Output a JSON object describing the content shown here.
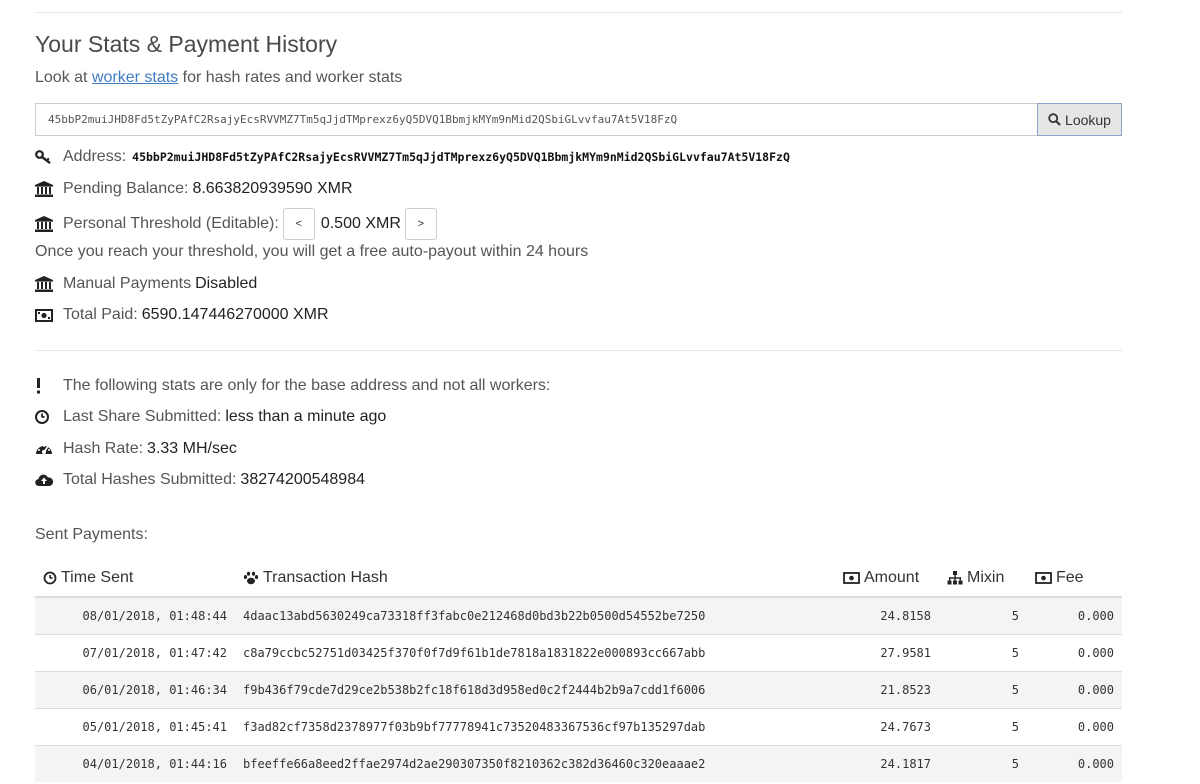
{
  "header": {
    "title": "Your Stats & Payment History",
    "subtitle_prefix": "Look at",
    "subtitle_link": "worker stats",
    "subtitle_suffix": "for hash rates and worker stats"
  },
  "lookup": {
    "value": "45bbP2muiJHD8Fd5tZyPAfC2RsajyEcsRVVMZ7Tm5qJjdTMprexz6yQ5DVQ1BbmjkMYm9nMid2QSbiGLvvfau7At5V18FzQ",
    "button_label": "Lookup",
    "button_icon": "search-icon"
  },
  "stats": {
    "address_label": "Address:",
    "address_value": "45bbP2muiJHD8Fd5tZyPAfC2RsajyEcsRVVMZ7Tm5qJjdTMprexz6yQ5DVQ1BbmjkMYm9nMid2QSbiGLvvfau7At5V18FzQ",
    "pending_label": "Pending Balance:",
    "pending_value": "8.663820939590 XMR",
    "threshold_label": "Personal Threshold (Editable):",
    "threshold_dec": "<",
    "threshold_value": "0.500 XMR",
    "threshold_inc": ">",
    "threshold_note": "Once you reach your threshold, you will get a free auto-payout within 24 hours",
    "manual_label": "Manual Payments",
    "manual_value": "Disabled",
    "total_paid_label": "Total Paid:",
    "total_paid_value": "6590.147446270000 XMR"
  },
  "base_stats": {
    "notice": "The following stats are only for the base address and not all workers:",
    "last_share_label": "Last Share Submitted:",
    "last_share_value": "less than a minute ago",
    "hash_rate_label": "Hash Rate:",
    "hash_rate_value": "3.33 MH/sec",
    "total_hashes_label": "Total Hashes Submitted:",
    "total_hashes_value": "38274200548984"
  },
  "payments": {
    "title": "Sent Payments:",
    "columns": [
      "Time Sent",
      "Transaction Hash",
      "Amount",
      "Mixin",
      "Fee"
    ],
    "rows": [
      {
        "time": "08/01/2018, 01:48:44",
        "hash": "4daac13abd5630249ca73318ff3fabc0e212468d0bd3b22b0500d54552be7250",
        "amount": "24.8158",
        "mixin": "5",
        "fee": "0.000"
      },
      {
        "time": "07/01/2018, 01:47:42",
        "hash": "c8a79ccbc52751d03425f370f0f7d9f61b1de7818a1831822e000893cc667abb",
        "amount": "27.9581",
        "mixin": "5",
        "fee": "0.000"
      },
      {
        "time": "06/01/2018, 01:46:34",
        "hash": "f9b436f79cde7d29ce2b538b2fc18f618d3d958ed0c2f2444b2b9a7cdd1f6006",
        "amount": "21.8523",
        "mixin": "5",
        "fee": "0.000"
      },
      {
        "time": "05/01/2018, 01:45:41",
        "hash": "f3ad82cf7358d2378977f03b9bf77778941c73520483367536cf97b135297dab",
        "amount": "24.7673",
        "mixin": "5",
        "fee": "0.000"
      },
      {
        "time": "04/01/2018, 01:44:16",
        "hash": "bfeeffe66a8eed2ffae2974d2ae290307350f8210362c382d36460c320eaaae2",
        "amount": "24.1817",
        "mixin": "5",
        "fee": "0.000"
      }
    ]
  }
}
